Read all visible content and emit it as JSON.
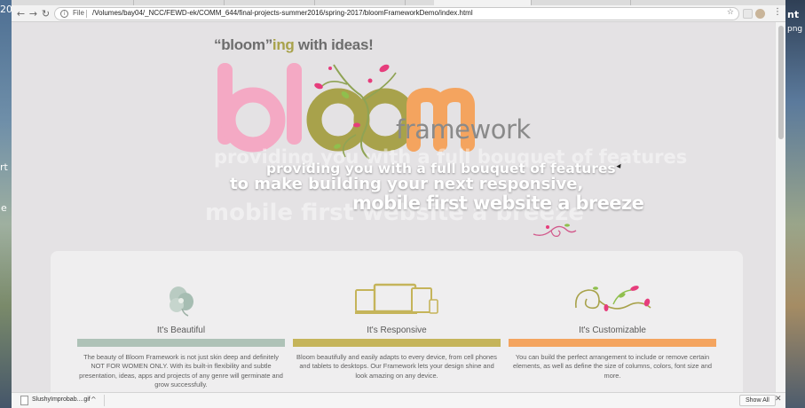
{
  "browser": {
    "scheme_label": "File",
    "url": "/Volumes/bay04/_NCC/FEWD-ek/COMM_644/final-projects-summer2016/spring-2017/bloomFrameworkDemo/index.html",
    "info_icon": "i",
    "star_icon": "☆",
    "menu_icon": "⋮"
  },
  "desktop": {
    "left_texts": [
      "20",
      "rt",
      "e"
    ],
    "right_texts": [
      "nt",
      "png"
    ]
  },
  "hero": {
    "tagline_open": "“bloom”",
    "tagline_ing": "ing",
    "tagline_rest": " with ideas!",
    "logo_word": "bl",
    "logo_word2": "m",
    "framework_word": "framework",
    "line1": "providing you with a full bouquet of features",
    "line2": "to make building your next responsive,",
    "line3": "mobile first website a breeze"
  },
  "features": [
    {
      "title": "It's Beautiful",
      "bar_color": "#aec2b7",
      "icon": "flower-icon",
      "description": "The beauty of Bloom Framework is not just skin deep and definitely NOT FOR WOMEN ONLY. With its built-in flexibility and subtle presentation, ideas, apps and projects of any genre will germinate and grow successfully."
    },
    {
      "title": "It's Responsive",
      "bar_color": "#c5b45a",
      "icon": "devices-icon",
      "description": "Bloom beautifully and easily adapts to every device, from cell phones and tablets to desktops. Our Framework lets your design shine and look amazing on any device."
    },
    {
      "title": "It's Customizable",
      "bar_color": "#f4a45f",
      "icon": "vine-icon",
      "description": "You can build the perfect arrangement to include or remove certain elements, as well as define the size of columns, colors, font size and more."
    }
  ],
  "downloads": {
    "file_name": "SlushyImprobab....gif",
    "caret": "^",
    "show_all_label": "Show All",
    "close_icon": "✕"
  },
  "colors": {
    "pink": "#f4a9c4",
    "olive": "#a8a24b",
    "orange": "#f4a45f",
    "sage": "#aec2b7",
    "page_bg": "#e4e2e4"
  }
}
